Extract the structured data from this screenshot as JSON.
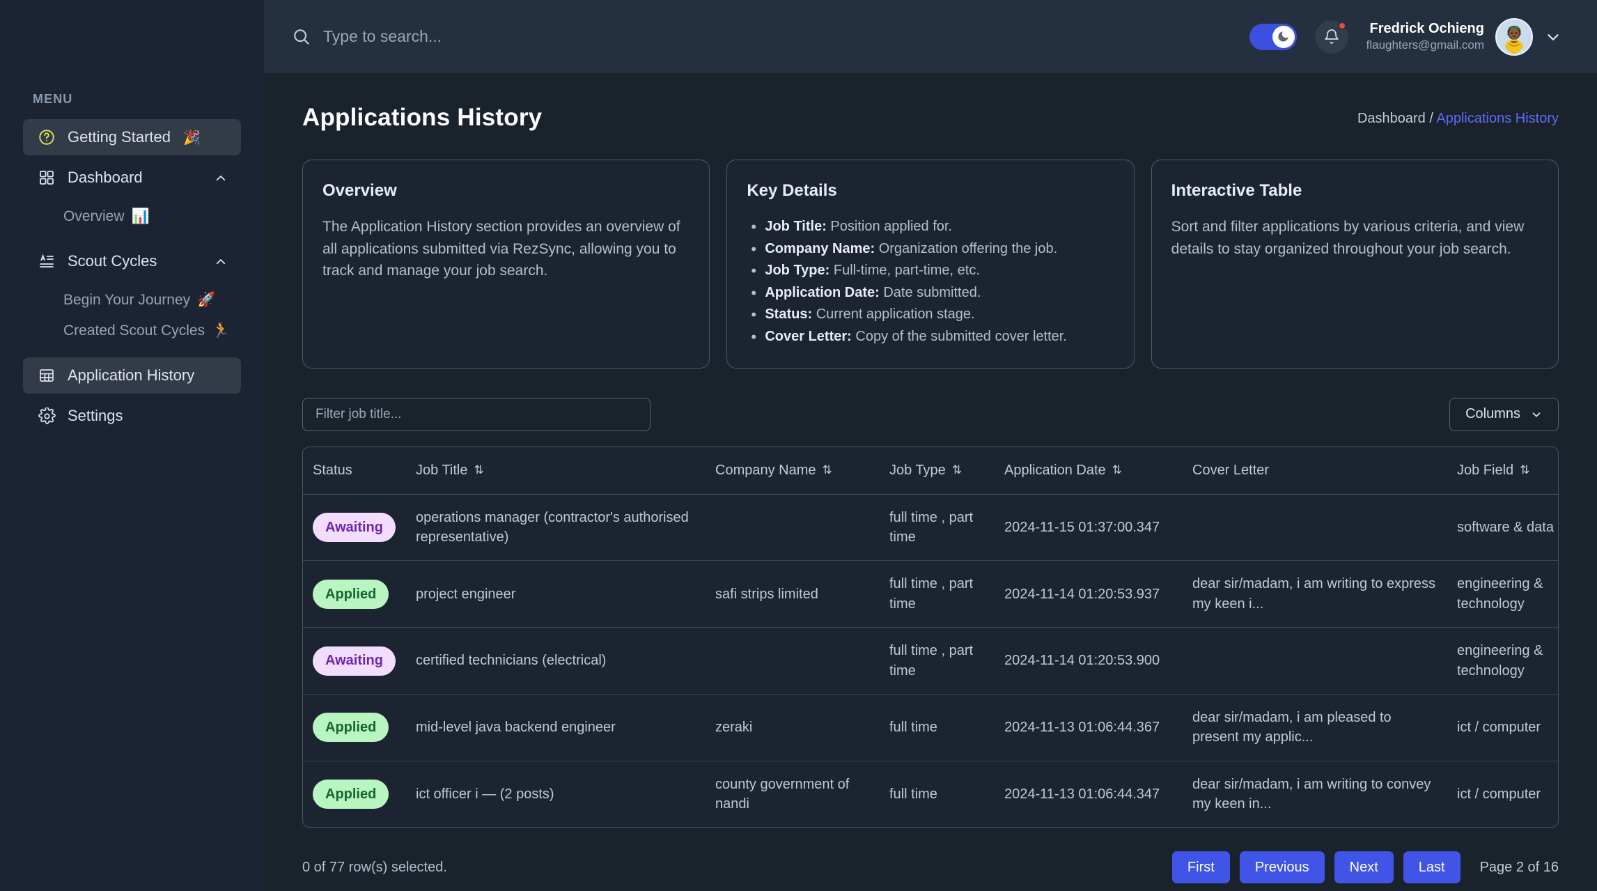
{
  "sidebar": {
    "menu_label": "MENU",
    "items": [
      {
        "label": "Getting Started",
        "emoji": "🎉",
        "icon": "question-circle-icon",
        "active": true
      },
      {
        "label": "Dashboard",
        "emoji": "",
        "icon": "grid-icon",
        "active": false,
        "expanded": true
      },
      {
        "label": "Scout Cycles",
        "emoji": "",
        "icon": "list-text-icon",
        "active": false,
        "expanded": true
      },
      {
        "label": "Application History",
        "emoji": "",
        "icon": "table-icon",
        "active": true
      },
      {
        "label": "Settings",
        "emoji": "",
        "icon": "gear-icon",
        "active": false
      }
    ],
    "dashboard_sub": [
      {
        "label": "Overview",
        "emoji": "📊"
      }
    ],
    "scout_sub": [
      {
        "label": "Begin Your Journey",
        "emoji": "🚀"
      },
      {
        "label": "Created Scout Cycles",
        "emoji": "🏃"
      }
    ]
  },
  "topbar": {
    "search_placeholder": "Type to search...",
    "search_value": "",
    "dark_mode_on": true,
    "notification_badge": true,
    "user_name": "Fredrick Ochieng",
    "user_email": "flaughters@gmail.com"
  },
  "page": {
    "title": "Applications History",
    "breadcrumb_root": "Dashboard",
    "breadcrumb_sep": "/",
    "breadcrumb_current": "Applications History"
  },
  "cards": {
    "overview": {
      "title": "Overview",
      "body": "The Application History section provides an overview of all applications submitted via RezSync, allowing you to track and manage your job search."
    },
    "key_details": {
      "title": "Key Details",
      "items": [
        {
          "term": "Job Title:",
          "desc": "Position applied for."
        },
        {
          "term": "Company Name:",
          "desc": "Organization offering the job."
        },
        {
          "term": "Job Type:",
          "desc": "Full-time, part-time, etc."
        },
        {
          "term": "Application Date:",
          "desc": "Date submitted."
        },
        {
          "term": "Status:",
          "desc": "Current application stage."
        },
        {
          "term": "Cover Letter:",
          "desc": "Copy of the submitted cover letter."
        }
      ]
    },
    "interactive_table": {
      "title": "Interactive Table",
      "body": "Sort and filter applications by various criteria, and view details to stay organized throughout your job search."
    }
  },
  "tools": {
    "filter_placeholder": "Filter job title...",
    "filter_value": "",
    "columns_label": "Columns"
  },
  "table": {
    "columns": [
      {
        "label": "Status",
        "sortable": false,
        "key": "status"
      },
      {
        "label": "Job Title",
        "sortable": true,
        "key": "job_title"
      },
      {
        "label": "Company Name",
        "sortable": true,
        "key": "company"
      },
      {
        "label": "Job Type",
        "sortable": true,
        "key": "job_type"
      },
      {
        "label": "Application Date",
        "sortable": true,
        "key": "app_date"
      },
      {
        "label": "Cover Letter",
        "sortable": false,
        "key": "cover"
      },
      {
        "label": "Job Field",
        "sortable": true,
        "key": "job_field"
      }
    ],
    "sort_glyph": "⇅",
    "rows": [
      {
        "status": "Awaiting",
        "status_kind": "awaiting",
        "job_title": "operations manager (contractor's authorised representative)",
        "company": "",
        "job_type": "full time , part time",
        "app_date": "2024-11-15 01:37:00.347",
        "cover": "",
        "job_field": "software & data"
      },
      {
        "status": "Applied",
        "status_kind": "applied",
        "job_title": "project engineer",
        "company": "safi strips limited",
        "job_type": "full time , part time",
        "app_date": "2024-11-14 01:20:53.937",
        "cover": "dear sir/madam, i am writing to express my keen i...",
        "job_field": "engineering & technology"
      },
      {
        "status": "Awaiting",
        "status_kind": "awaiting",
        "job_title": "certified technicians (electrical)",
        "company": "",
        "job_type": "full time , part time",
        "app_date": "2024-11-14 01:20:53.900",
        "cover": "",
        "job_field": "engineering & technology"
      },
      {
        "status": "Applied",
        "status_kind": "applied",
        "job_title": "mid-level java backend engineer",
        "company": "zeraki",
        "job_type": "full time",
        "app_date": "2024-11-13 01:06:44.367",
        "cover": "dear sir/madam, i am pleased to present my applic...",
        "job_field": "ict / computer"
      },
      {
        "status": "Applied",
        "status_kind": "applied",
        "job_title": "ict officer i — (2 posts)",
        "company": "county government of nandi",
        "job_type": "full time",
        "app_date": "2024-11-13 01:06:44.347",
        "cover": "dear sir/madam, i am writing to convey my keen in...",
        "job_field": "ict / computer"
      }
    ]
  },
  "footer": {
    "rows_selected": "0 of 77 row(s) selected.",
    "buttons": [
      "First",
      "Previous",
      "Next",
      "Last"
    ],
    "page_info": "Page 2 of 16"
  },
  "colors": {
    "accent": "#3c50e0",
    "pager": "#4055e8",
    "link": "#5b6ef5",
    "sidebar_bg": "#1c2434",
    "topbar_bg": "#24303f",
    "content_bg": "#1a222c",
    "badge_awaiting_bg": "#f3ddff",
    "badge_awaiting_fg": "#6d28a8",
    "badge_applied_bg": "#b8f5c0",
    "badge_applied_fg": "#166534",
    "notification_dot": "#e74c3c"
  }
}
